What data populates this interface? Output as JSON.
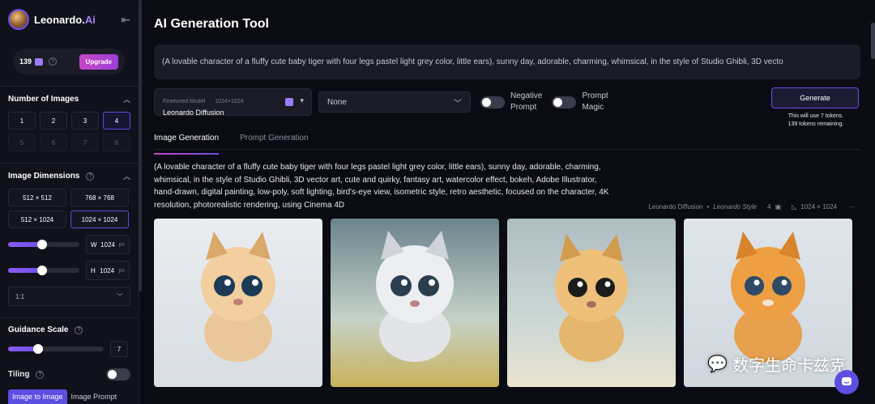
{
  "brand": {
    "name": "Leonardo.",
    "suffix": "Ai"
  },
  "tokens": {
    "count": "139",
    "upgrade_label": "Upgrade"
  },
  "sidebar": {
    "num_images_title": "Number of Images",
    "num_images": [
      "1",
      "2",
      "3",
      "4",
      "5",
      "6",
      "7",
      "8"
    ],
    "num_selected": "4",
    "dimensions_title": "Image Dimensions",
    "dimensions": [
      "512 × 512",
      "768 × 768",
      "512 × 1024",
      "1024 × 1024"
    ],
    "dim_selected": "1024 × 1024",
    "width_label": "W",
    "width_value": "1024",
    "height_label": "H",
    "height_value": "1024",
    "unit": "px",
    "width_fraction": 0.48,
    "height_fraction": 0.48,
    "ratio": "1:1",
    "guidance_title": "Guidance Scale",
    "guidance_value": "7",
    "guidance_fraction": 0.31,
    "tiling_title": "Tiling",
    "bottom_tabs": [
      "Image to Image",
      "Image Prompt"
    ]
  },
  "main": {
    "title": "AI Generation Tool",
    "prompt": "(A lovable character of a fluffy cute baby tiger with four legs pastel light grey color, little ears), sunny day, adorable, charming, whimsical, in the style of Studio Ghibli, 3D vecto",
    "model_label": "Finetuned Model",
    "model_res": "1024×1024",
    "model_name": "Leonardo Diffusion",
    "style": "None",
    "negative_prompt_label": [
      "Negative",
      "Prompt"
    ],
    "prompt_magic_label": [
      "Prompt",
      "Magic"
    ],
    "generate_label": "Generate",
    "generate_note_1": "This will use 7 tokens.",
    "generate_note_2": "139 tokens remaining.",
    "tabs": [
      "Image Generation",
      "Prompt Generation"
    ],
    "result_prompt": "(A lovable character of a fluffy cute baby tiger with four legs pastel light grey color, little ears), sunny day, adorable, charming, whimsical, in the style of Studio Ghibli, 3D vector art, cute and quirky, fantasy art, watercolor effect, bokeh, Adobe Illustrator, hand-drawn, digital painting, low-poly, soft lighting, bird's-eye view, isometric style, retro aesthetic, focused on the character, 4K resolution, photorealistic rendering, using Cinema 4D",
    "meta_model": "Leonardo Diffusion",
    "meta_style": "Leonardo Style",
    "meta_count": "4",
    "meta_dims": "1024 × 1024",
    "more": "···"
  },
  "watermark": "数字生命卡兹克",
  "colors": {
    "accent": "#6d4ee8",
    "upgrade": "#c847c7",
    "bg": "#0b0c13"
  }
}
